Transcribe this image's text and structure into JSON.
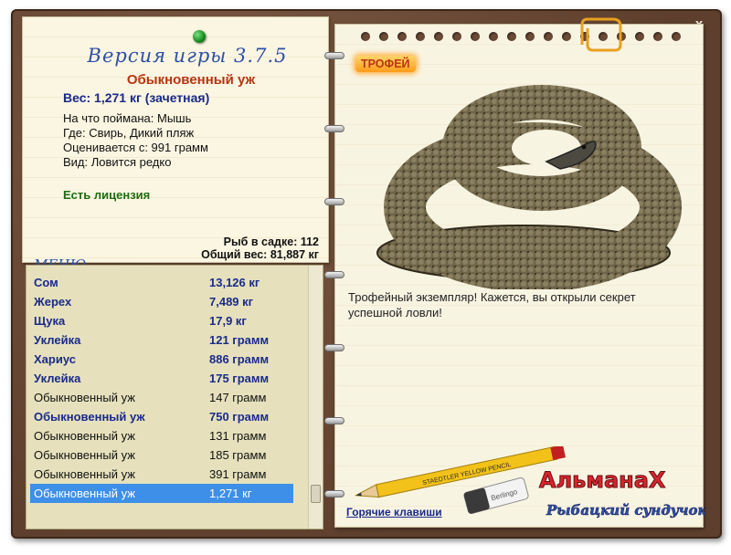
{
  "window": {
    "close_label": "x"
  },
  "card": {
    "version": "Версия игры 3.7.5",
    "fish_name": "Обыкновенный уж",
    "weight_line": "Вес: 1,271 кг (зачетная)",
    "info": [
      "На что поймана: Мышь",
      "Где: Свирь, Дикий пляж",
      "Оценивается с: 991 грамм",
      "Вид: Ловится редко"
    ],
    "license": "Есть лицензия",
    "summary": {
      "count_label": "Рыб в садке: 112",
      "total_weight": "Общий вес: 81,887 кг"
    },
    "menu_label": "МЕНЮ"
  },
  "catch_list": {
    "rows": [
      {
        "name": "Сом",
        "weight": "13,126 кг",
        "bold": true,
        "selected": false
      },
      {
        "name": "Жерех",
        "weight": "7,489 кг",
        "bold": true,
        "selected": false
      },
      {
        "name": "Щука",
        "weight": "17,9 кг",
        "bold": true,
        "selected": false
      },
      {
        "name": "Уклейка",
        "weight": "121 грамм",
        "bold": true,
        "selected": false
      },
      {
        "name": "Хариус",
        "weight": "886 грамм",
        "bold": true,
        "selected": false
      },
      {
        "name": "Уклейка",
        "weight": "175 грамм",
        "bold": true,
        "selected": false
      },
      {
        "name": "Обыкновенный уж",
        "weight": "147 грамм",
        "bold": false,
        "selected": false
      },
      {
        "name": "Обыкновенный уж",
        "weight": "750 грамм",
        "bold": true,
        "selected": false
      },
      {
        "name": "Обыкновенный уж",
        "weight": "131 грамм",
        "bold": false,
        "selected": false
      },
      {
        "name": "Обыкновенный уж",
        "weight": "185 грамм",
        "bold": false,
        "selected": false
      },
      {
        "name": "Обыкновенный уж",
        "weight": "391 грамм",
        "bold": false,
        "selected": false
      },
      {
        "name": "Обыкновенный уж",
        "weight": "1,271 кг",
        "bold": false,
        "selected": true
      }
    ]
  },
  "detail": {
    "trophy_badge": "ТРОФЕЙ",
    "description": "Трофейный экземпляр! Кажется, вы открыли секрет успешной ловли!",
    "hotkeys_label": "Горячие клавиши"
  },
  "branding": {
    "almanac_title": "АльманаХ",
    "almanac_subtitle": "Рыбацкий сундучок",
    "pencil_text": "STAEDTLER YELLOW PENCIL",
    "eraser_text": "Berlingo"
  },
  "colors": {
    "accent_blue": "#2f4fa8",
    "title_red": "#b8350f",
    "license_green": "#1e6b12",
    "selection": "#3d8fe8"
  }
}
